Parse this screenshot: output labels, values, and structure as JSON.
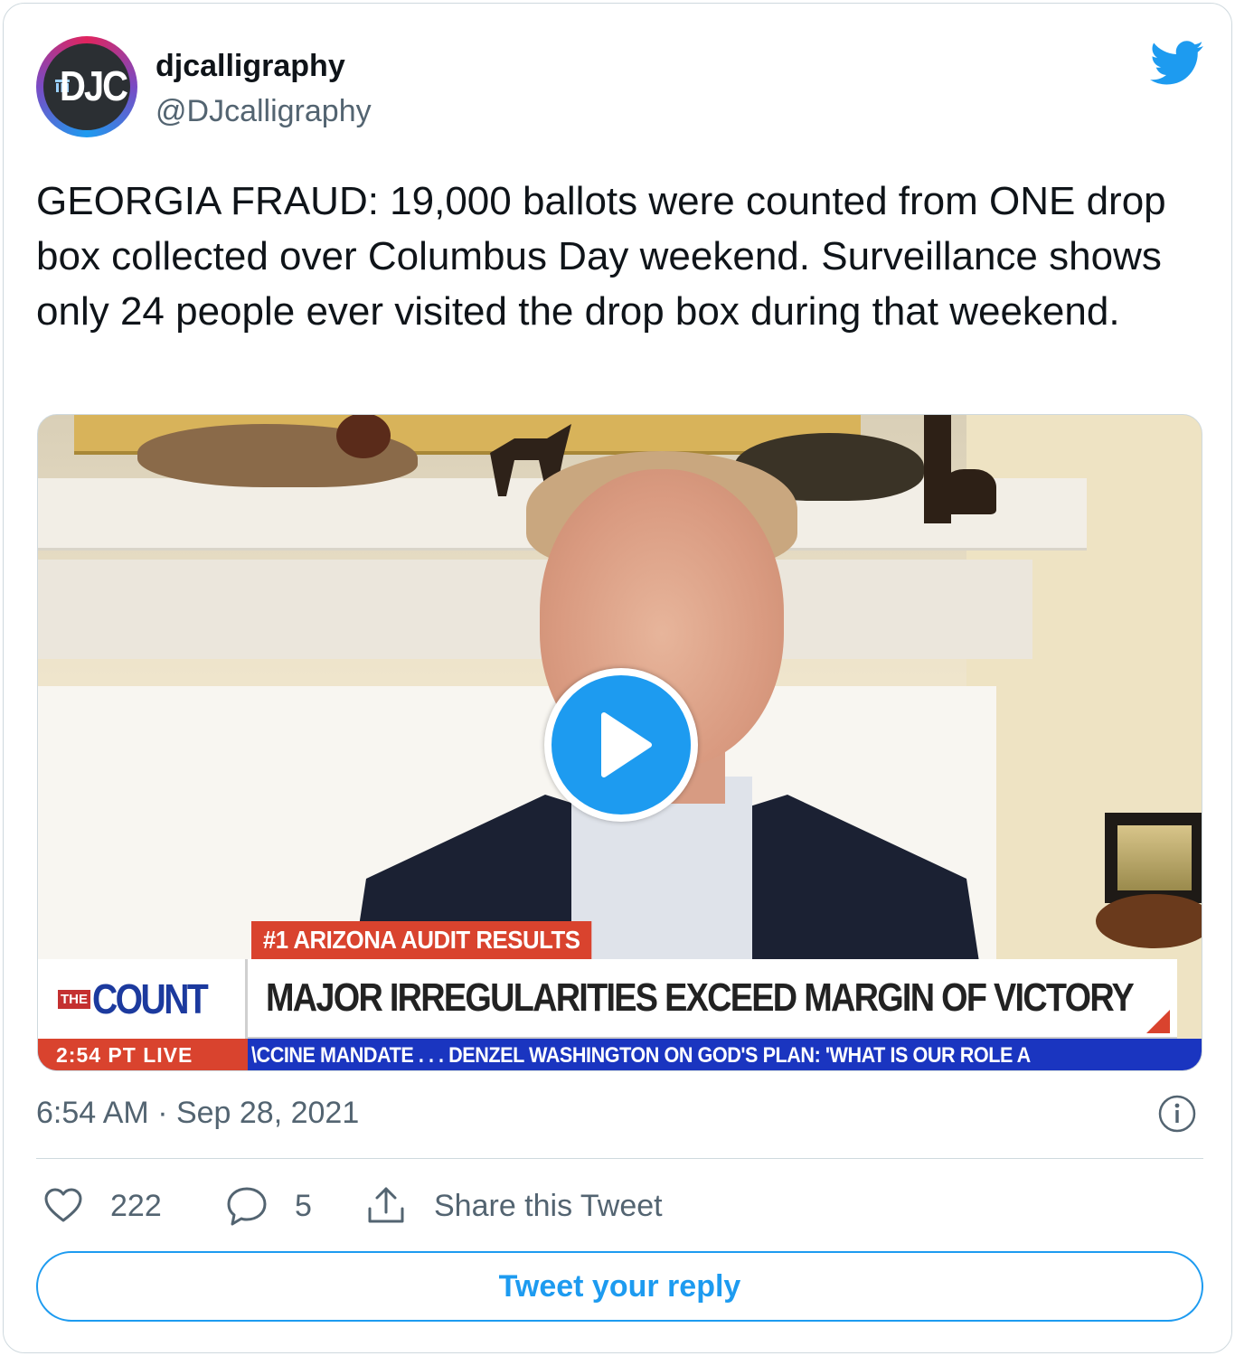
{
  "user": {
    "display_name": "djcalligraphy",
    "handle": "@DJcalligraphy",
    "avatar_text": "DJC"
  },
  "tweet": {
    "text": "GEORGIA FRAUD: 19,000 ballots were counted from ONE drop box collected over Columbus Day weekend. Surveillance shows only 24 people ever visited the drop box during that weekend.",
    "timestamp": "6:54 AM · Sep 28, 2021"
  },
  "media": {
    "type": "video",
    "banner_small": "#1  ARIZONA AUDIT RESULTS",
    "logo_the": "THE",
    "logo_count": "COUNT",
    "headline": "MAJOR IRREGULARITIES EXCEED MARGIN OF VICTORY",
    "ticker_time": "2:54 PT   LIVE",
    "ticker_text": "\\CCINE MANDATE . . .      DENZEL WASHINGTON ON GOD'S PLAN: 'WHAT IS OUR ROLE A"
  },
  "actions": {
    "like_count": "222",
    "reply_count": "5",
    "share_label": "Share this Tweet"
  },
  "reply_button_label": "Tweet your reply",
  "colors": {
    "accent": "#1d9bf0",
    "secondary_text": "#536471",
    "border": "#cfd9de"
  },
  "icons": {
    "brand": "twitter-bird-icon",
    "play": "play-icon",
    "info": "info-icon",
    "like": "heart-icon",
    "reply": "speech-bubble-icon",
    "share": "share-upload-icon"
  }
}
